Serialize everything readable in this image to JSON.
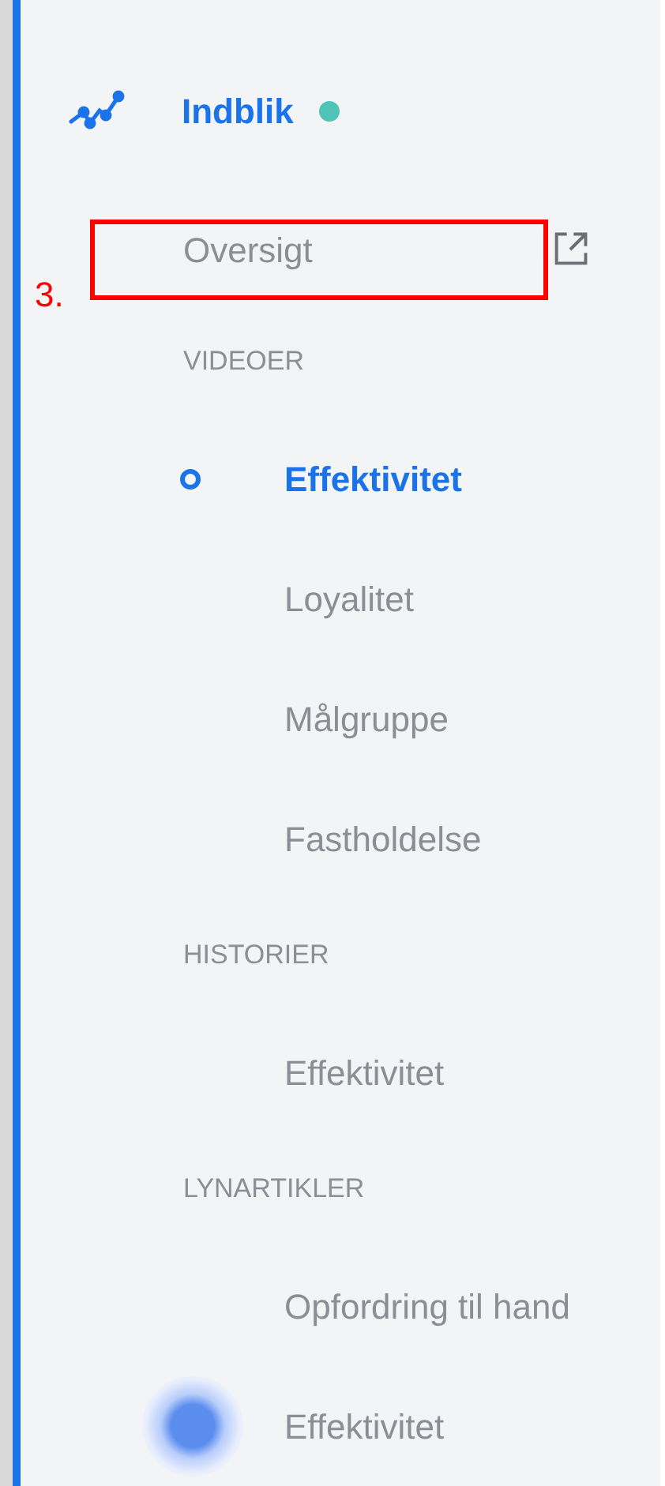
{
  "header": {
    "title": "Indblik",
    "status_dot": true
  },
  "overview": {
    "label": "Oversigt"
  },
  "sections": [
    {
      "heading": "VIDEOER",
      "items": [
        {
          "label": "Effektivitet",
          "selected": true,
          "hotspot": false
        },
        {
          "label": "Loyalitet",
          "selected": false,
          "hotspot": false
        },
        {
          "label": "Målgruppe",
          "selected": false,
          "hotspot": false
        },
        {
          "label": "Fastholdelse",
          "selected": false,
          "hotspot": false
        }
      ]
    },
    {
      "heading": "HISTORIER",
      "items": [
        {
          "label": "Effektivitet",
          "selected": false,
          "hotspot": false
        }
      ]
    },
    {
      "heading": "LYNARTIKLER",
      "items": [
        {
          "label": "Opfordring til hand",
          "selected": false,
          "hotspot": false
        },
        {
          "label": "Effektivitet",
          "selected": false,
          "hotspot": true
        }
      ]
    }
  ],
  "annotation": {
    "label": "3."
  }
}
